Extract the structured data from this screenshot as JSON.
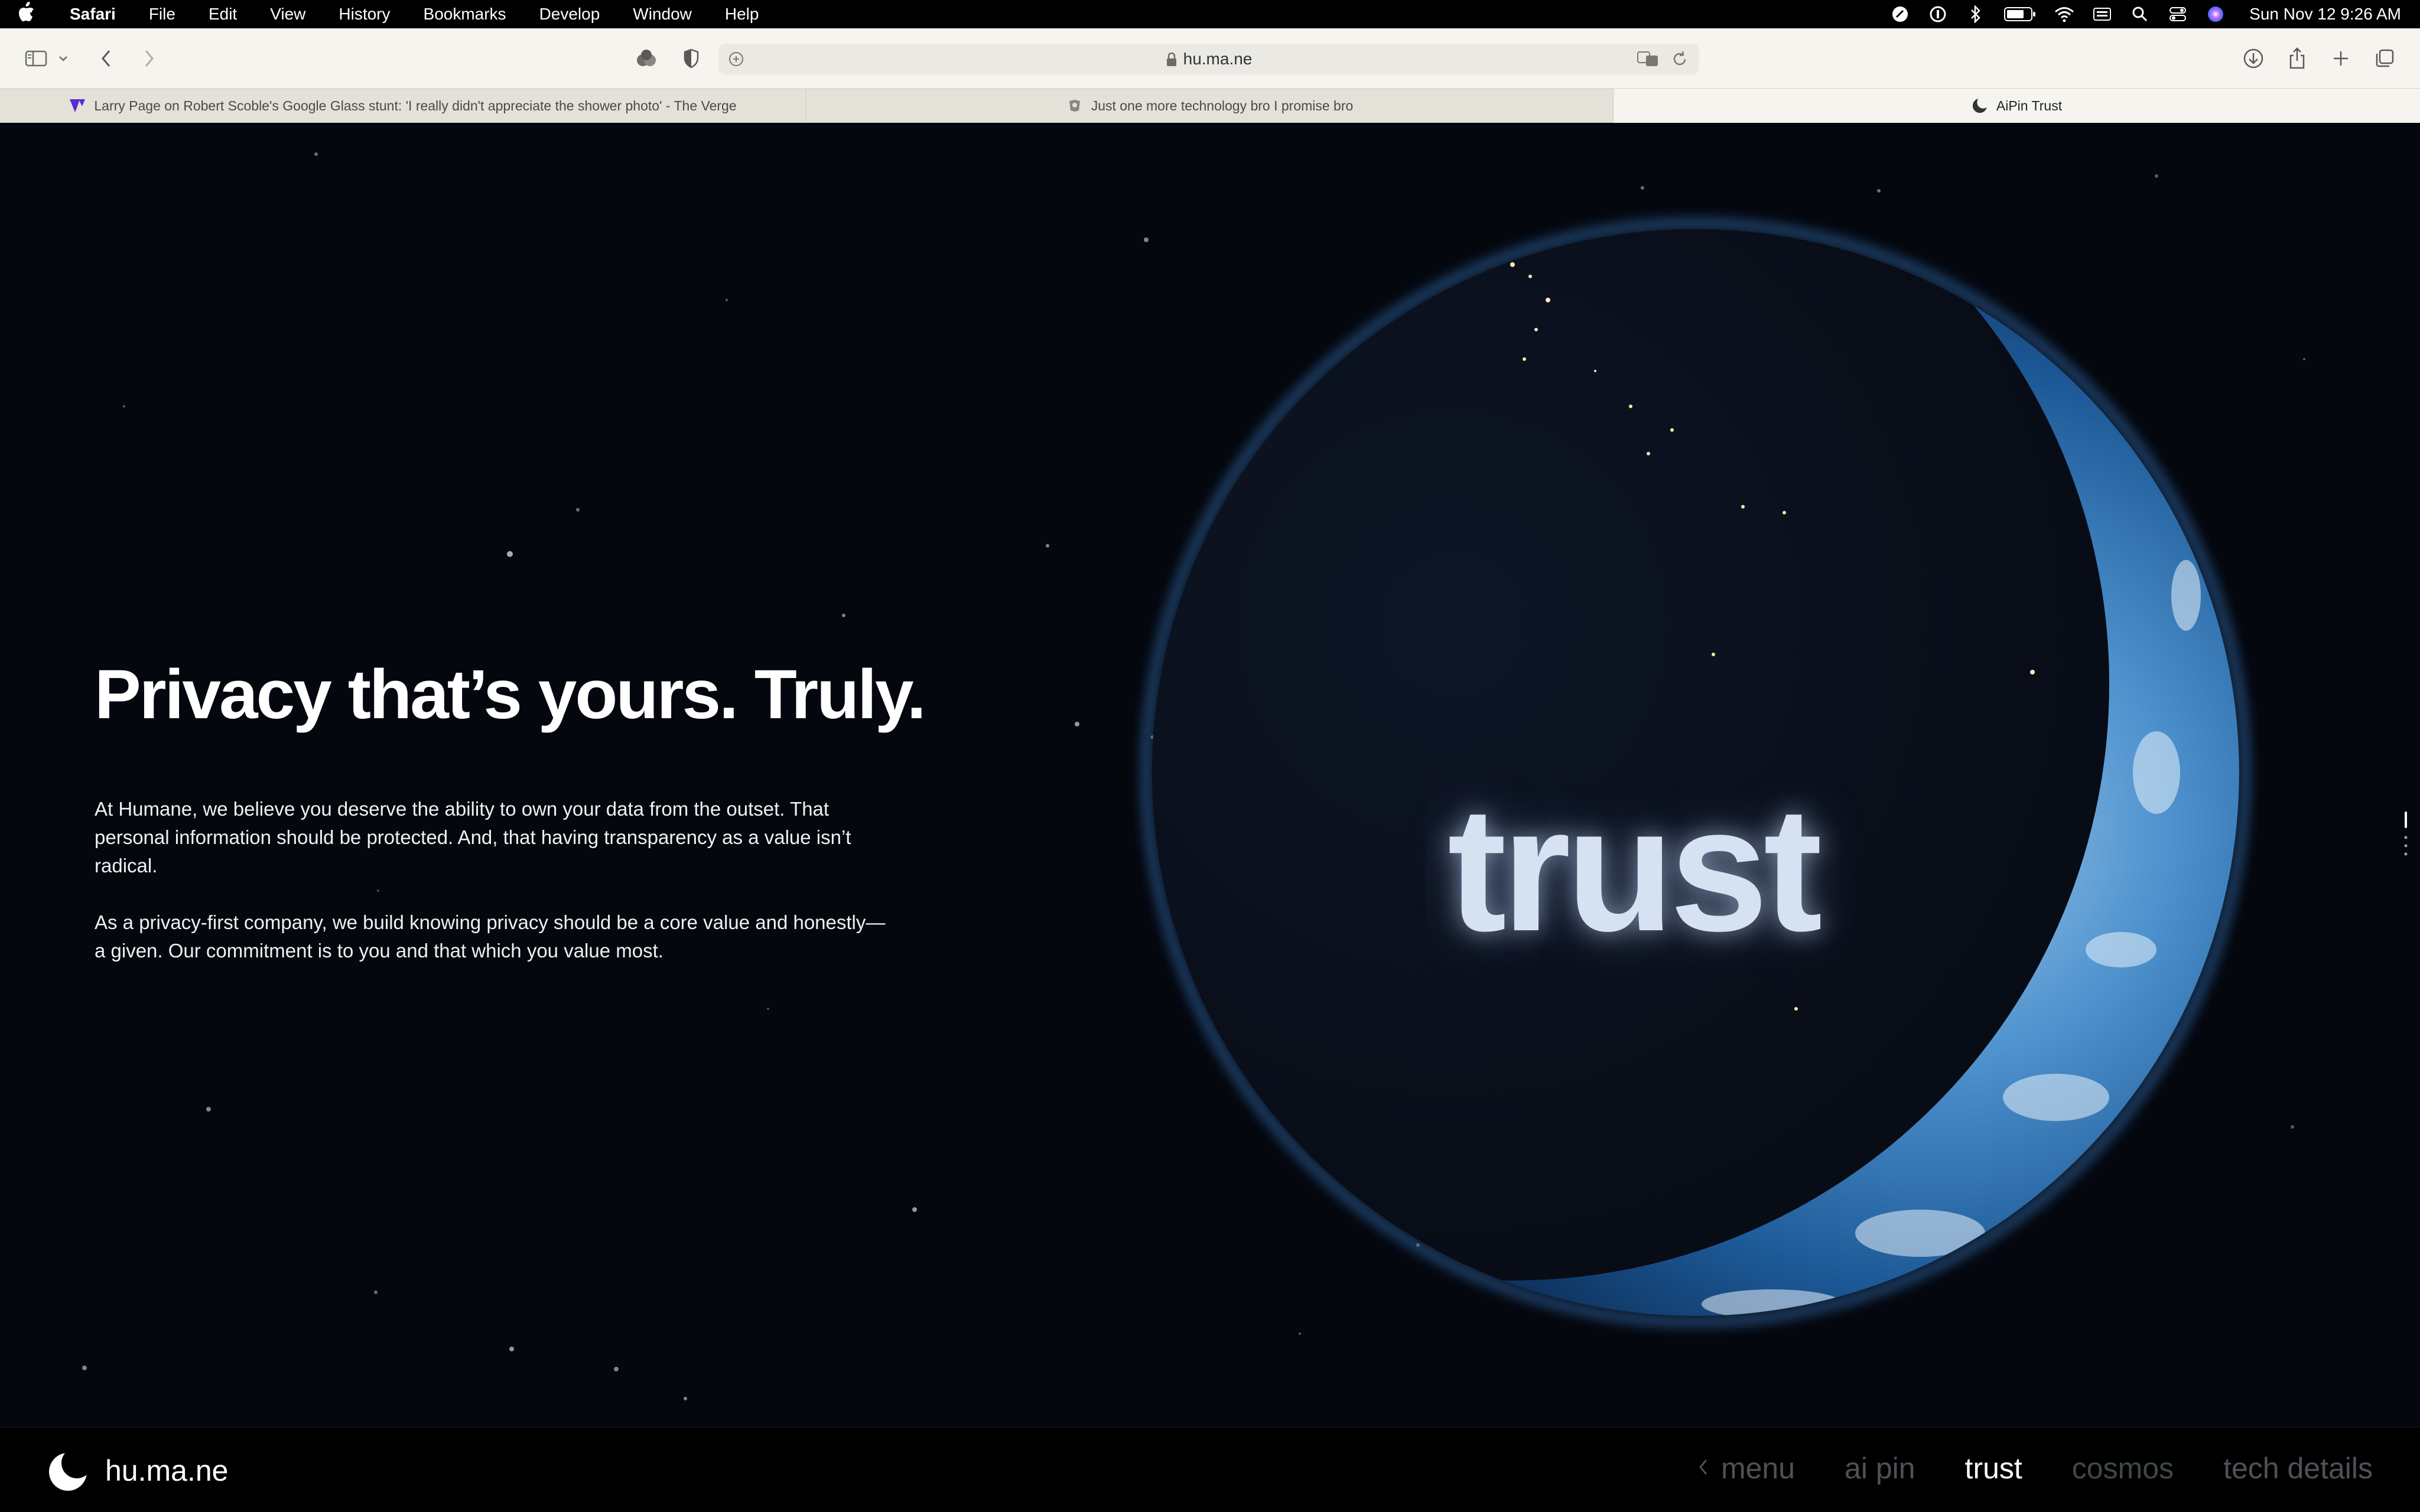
{
  "menubar": {
    "app": "Safari",
    "items": [
      "File",
      "Edit",
      "View",
      "History",
      "Bookmarks",
      "Develop",
      "Window",
      "Help"
    ],
    "clock": "Sun Nov 12  9:26 AM"
  },
  "toolbar": {
    "url": "hu.ma.ne"
  },
  "tabs": [
    {
      "title": "Larry Page on Robert Scoble's Google Glass stunt: 'I really didn't appreciate the shower photo' - The Verge",
      "favicon": "verge-icon"
    },
    {
      "title": "Just one more technology bro I promise bro",
      "favicon": "site-icon"
    },
    {
      "title": "AiPin Trust",
      "favicon": "humane-icon"
    }
  ],
  "hero": {
    "title": "Privacy that’s yours. Truly.",
    "paragraph1": "At Humane, we believe you deserve the ability to own your data from the outset. That personal information should be protected. And, that having transparency as a value isn’t radical.",
    "paragraph2": "As a privacy-first company, we build knowing privacy should be a core value and honestly—a given. Our commitment is to you and that which you value most.",
    "image_word": "trust"
  },
  "footer": {
    "logo_text": "hu.ma.ne",
    "nav": {
      "menu": "menu",
      "aipin": "ai pin",
      "trust": "trust",
      "cosmos": "cosmos",
      "tech": "tech details"
    }
  },
  "colors": {
    "background": "#04070e",
    "toolbar": "#f6f4ee",
    "accent_planet": "#3b8ed6"
  }
}
